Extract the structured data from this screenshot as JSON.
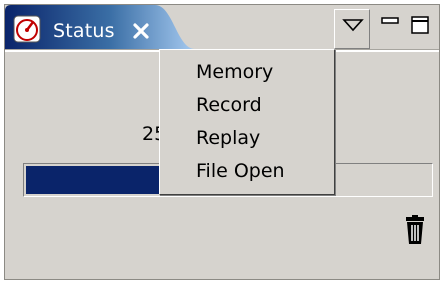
{
  "view": {
    "tab_title": "Status",
    "tab_icon": "speedometer-icon",
    "close_icon": "close-icon",
    "menu_button_icon": "chevron-down-icon",
    "minimize_icon": "minimize-icon",
    "maximize_icon": "maximize-icon"
  },
  "content": {
    "value_text": "25",
    "progress_fraction": 0.75,
    "delete_icon": "trash-icon"
  },
  "menu": {
    "items": [
      {
        "label": "Memory"
      },
      {
        "label": "Record"
      },
      {
        "label": "Replay"
      },
      {
        "label": "File Open"
      }
    ]
  },
  "colors": {
    "tab_active": "#0a246a",
    "progress_fill": "#0a246a",
    "background": "#d6d3ce"
  }
}
